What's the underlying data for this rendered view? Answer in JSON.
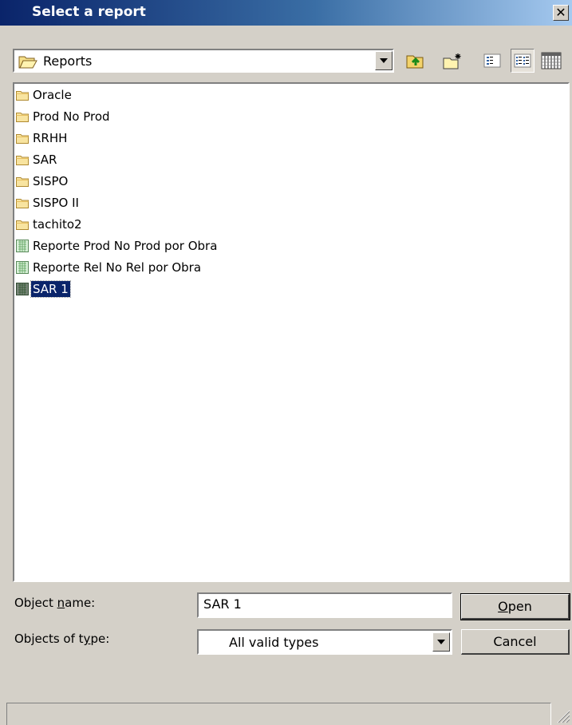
{
  "window": {
    "title": "Select a report",
    "close_glyph": "✕"
  },
  "location": {
    "current_folder": "Reports"
  },
  "toolbar": {
    "buttons": [
      {
        "name": "up-one-level",
        "icon": "folder-up-icon"
      },
      {
        "name": "create-new-folder",
        "icon": "new-folder-icon"
      },
      {
        "name": "list-view",
        "icon": "list-view-icon"
      },
      {
        "name": "details-view",
        "icon": "details-view-icon",
        "pressed": true
      },
      {
        "name": "grid-view",
        "icon": "grid-view-icon"
      }
    ]
  },
  "files": [
    {
      "name": "Oracle",
      "type": "folder"
    },
    {
      "name": "Prod No Prod",
      "type": "folder"
    },
    {
      "name": "RRHH",
      "type": "folder"
    },
    {
      "name": "SAR",
      "type": "folder"
    },
    {
      "name": "SISPO",
      "type": "folder"
    },
    {
      "name": "SISPO II",
      "type": "folder"
    },
    {
      "name": "tachito2",
      "type": "folder"
    },
    {
      "name": "Reporte Prod No Prod por Obra",
      "type": "report"
    },
    {
      "name": "Reporte Rel No Rel por Obra",
      "type": "report"
    },
    {
      "name": "SAR 1",
      "type": "report",
      "selected": true
    }
  ],
  "fields": {
    "object_name_label_pre": "Object ",
    "object_name_label_acc": "n",
    "object_name_label_post": "ame:",
    "object_name_value": "SAR 1",
    "objects_type_label_pre": "Objects of t",
    "objects_type_label_acc": "y",
    "objects_type_label_post": "pe:",
    "objects_type_value": "All valid types"
  },
  "buttons": {
    "open_acc": "O",
    "open_rest": "pen",
    "cancel": "Cancel"
  },
  "colors": {
    "title_gradient_start": "#0a246a",
    "title_gradient_end": "#a6caf0",
    "dialog_bg": "#d4d0c8",
    "selection": "#0a246a"
  }
}
